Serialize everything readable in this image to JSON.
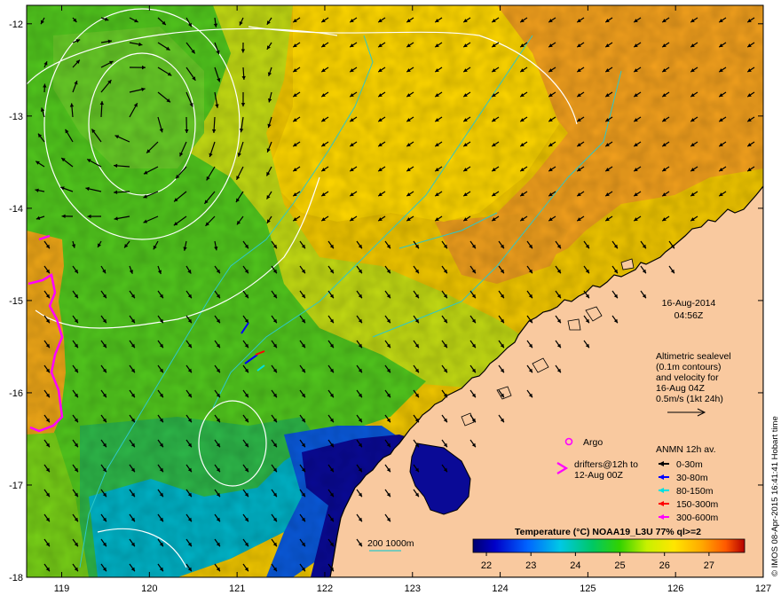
{
  "map": {
    "x_ticks": [
      "119",
      "120",
      "121",
      "122",
      "123",
      "124",
      "125",
      "126",
      "127"
    ],
    "y_ticks": [
      "-12",
      "-13",
      "-14",
      "-15",
      "-16",
      "-17",
      "-18"
    ],
    "lon_range": [
      118.6,
      127.0
    ],
    "lat_range": [
      -18.0,
      -11.8
    ]
  },
  "annotations": {
    "date": "16-Aug-2014",
    "time": "04:56Z",
    "altimetric_line1": "Altimetric sealevel",
    "altimetric_line2": "(0.1m contours)",
    "altimetric_line3": "and velocity for",
    "altimetric_line4": "16-Aug 04Z",
    "altimetric_line5": "0.5m/s (1kt 24h)",
    "argo_label": "Argo",
    "drifters_line1": "drifters@12h to",
    "drifters_line2": "12-Aug 00Z",
    "anmn_title": "ANMN 12h av.",
    "depth_bands": [
      {
        "label": "0-30m",
        "color": "#000000"
      },
      {
        "label": "30-80m",
        "color": "#0000ff"
      },
      {
        "label": "80-150m",
        "color": "#00e0e0"
      },
      {
        "label": "150-300m",
        "color": "#ff0000"
      },
      {
        "label": "300-600m",
        "color": "#ff00ff"
      }
    ],
    "bathy_label": "200  1000m",
    "credit": "© IMOS 08-Apr-2015 16:41:41 Hobart time"
  },
  "colorbar": {
    "title": "Temperature (°C) NOAA19_L3U 77% ql>=2",
    "ticks": [
      "22",
      "23",
      "24",
      "25",
      "26",
      "27"
    ],
    "range": [
      21.7,
      27.8
    ]
  },
  "colors": {
    "land": "#f9c99f",
    "cold_dark": "#00008c",
    "cool_blue": "#0064e6",
    "cyan": "#00c8c8",
    "green": "#32c800",
    "yellow_green": "#c8e600",
    "yellow": "#ffd200",
    "orange": "#ffa000",
    "contour": "#ffffff",
    "bathy": "#2ec8c8"
  }
}
